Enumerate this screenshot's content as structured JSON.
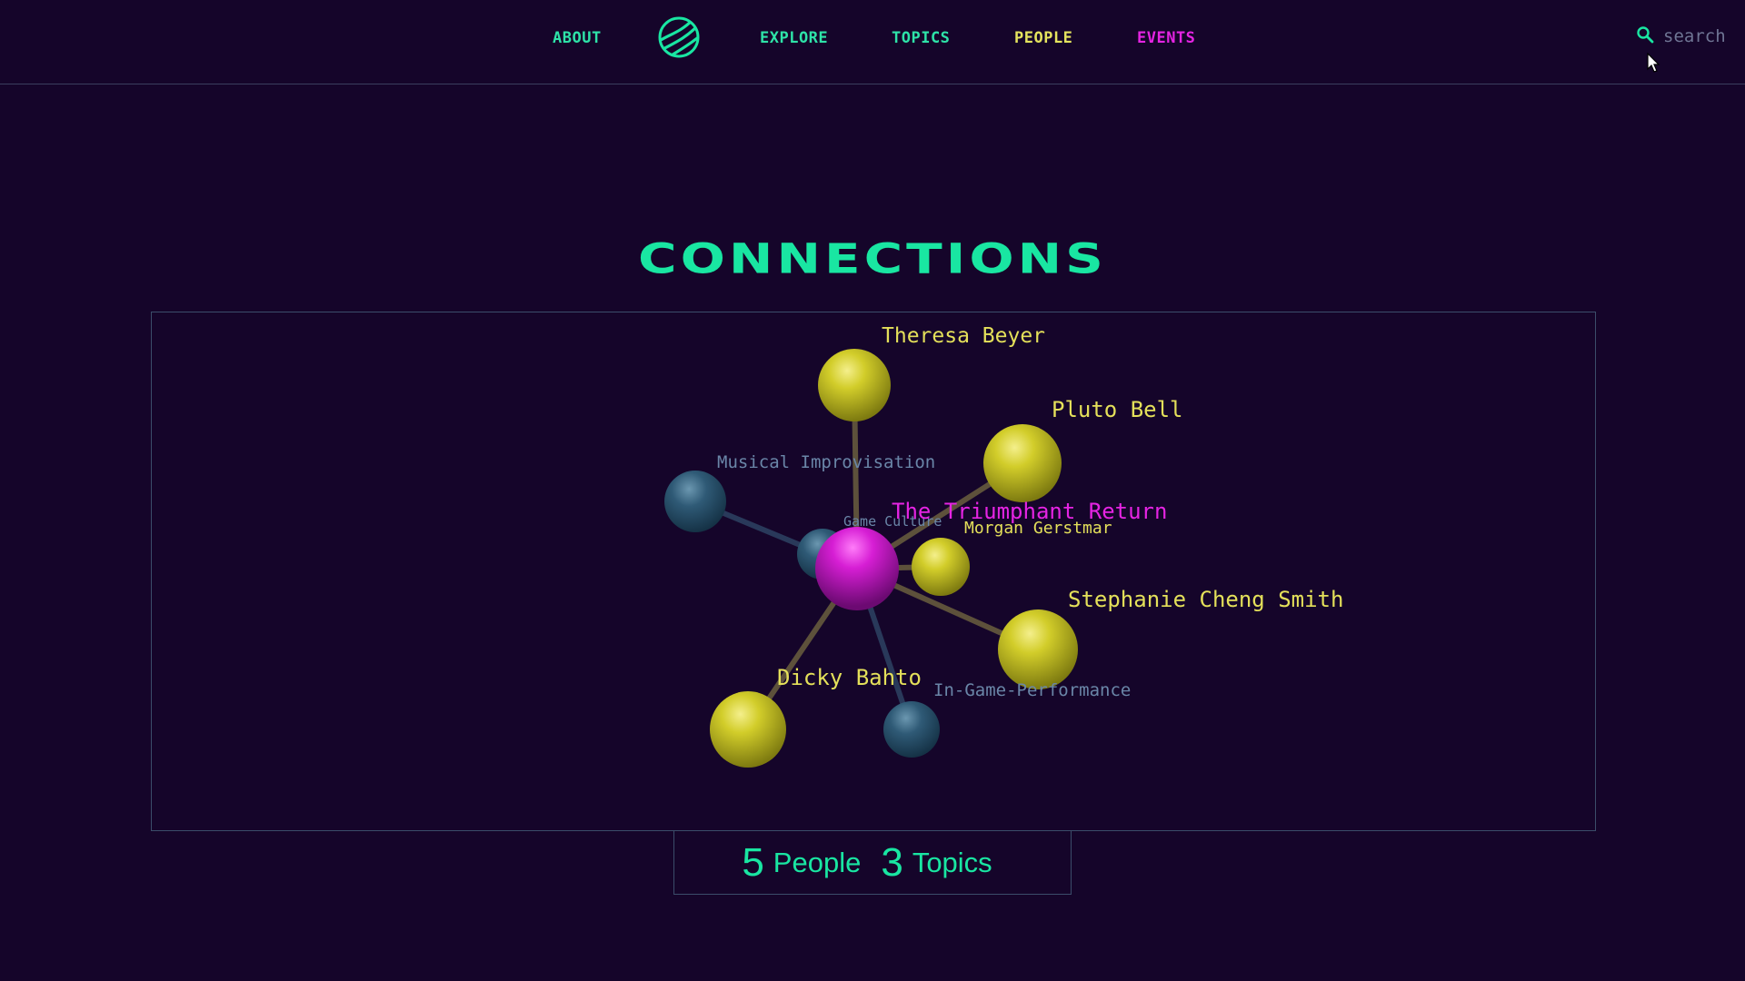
{
  "colors": {
    "background": "#15052a",
    "accent_green": "#19e6a2",
    "accent_magenta": "#e524e3",
    "person_yellow": "#d8d23a",
    "topic_blue": "#2f5a76",
    "topic_label": "#6a86a8",
    "nav_green": "#2ee3a8",
    "nav_yellow": "#e5e45e"
  },
  "nav": {
    "about": "ABOUT",
    "explore": "EXPLORE",
    "topics": "TOPICS",
    "people": "PEOPLE",
    "events": "EVENTS",
    "logo_icon": "globe-stripes-icon"
  },
  "search": {
    "placeholder": "search",
    "icon": "search-icon"
  },
  "page": {
    "title": "CONNECTIONS"
  },
  "graph": {
    "center": {
      "label": "The Triumphant Return",
      "type": "event"
    },
    "people": [
      {
        "label": "Theresa Beyer"
      },
      {
        "label": "Pluto Bell"
      },
      {
        "label": "Morgan Gerstmar"
      },
      {
        "label": "Stephanie Cheng Smith"
      },
      {
        "label": "Dicky Bahto"
      }
    ],
    "topics": [
      {
        "label": "Musical Improvisation"
      },
      {
        "label": "Game Culture"
      },
      {
        "label": "In-Game-Performance"
      }
    ]
  },
  "stats": {
    "people_count": "5",
    "people_label": "People",
    "topics_count": "3",
    "topics_label": "Topics"
  }
}
